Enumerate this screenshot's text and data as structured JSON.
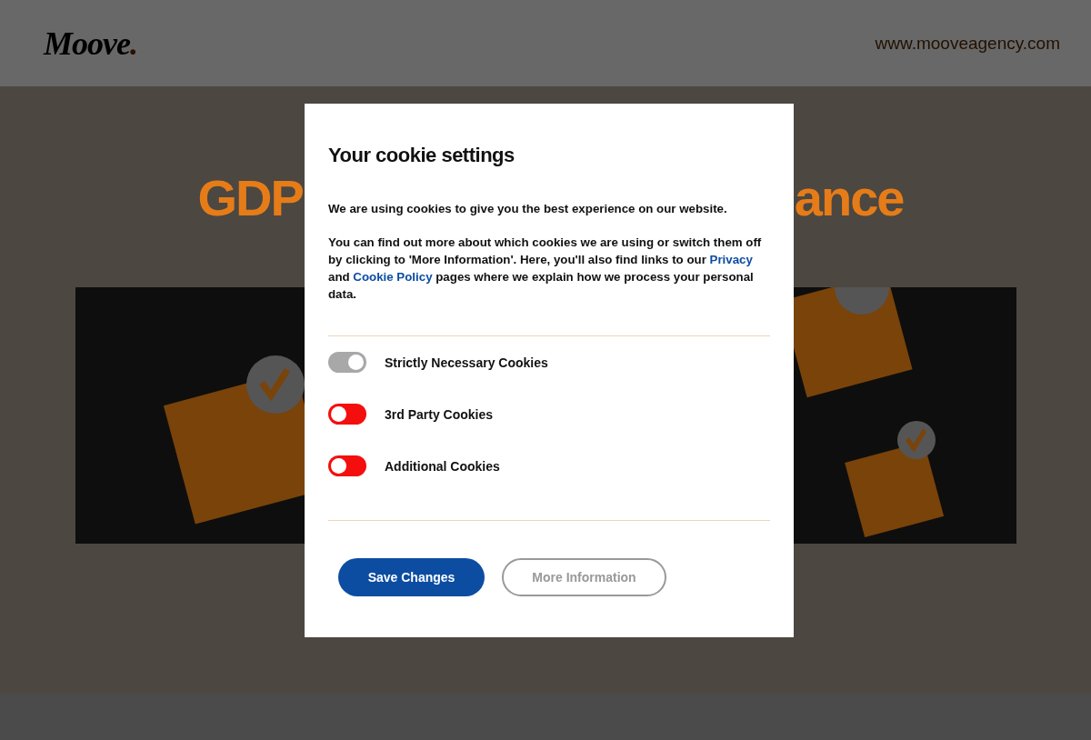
{
  "header": {
    "logo": "Moove",
    "logo_dot": ".",
    "url": "www.mooveagency.com"
  },
  "hero": {
    "heading_left": "GDP",
    "heading_right": "ance"
  },
  "modal": {
    "title": "Your cookie settings",
    "intro": "We are using cookies to give you the best experience on our website.",
    "details": [
      {
        "kind": "text",
        "text": "You can find out more about which cookies we are using or switch them off by clicking to 'More Information'. Here, you'll also find links to our "
      },
      {
        "kind": "link",
        "text": "Privacy"
      },
      {
        "kind": "text",
        "text": " and "
      },
      {
        "kind": "link",
        "text": "Cookie Policy"
      },
      {
        "kind": "text",
        "text": " pages where we explain how we process your personal data."
      }
    ],
    "toggles": [
      {
        "label": "Strictly Necessary Cookies",
        "on": true,
        "disabled": true
      },
      {
        "label": "3rd Party Cookies",
        "on": false,
        "disabled": false
      },
      {
        "label": "Additional Cookies",
        "on": false,
        "disabled": false
      }
    ],
    "buttons": [
      {
        "kind": "primary",
        "label": "Save Changes"
      },
      {
        "kind": "secondary",
        "label": "More Information"
      }
    ]
  }
}
